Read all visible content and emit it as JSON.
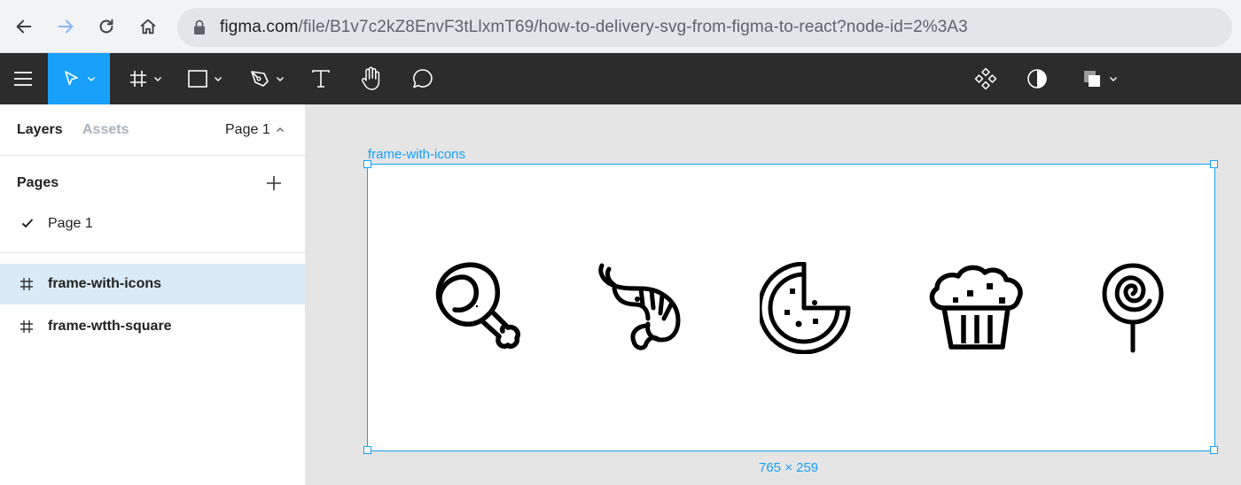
{
  "browser": {
    "url_host": "figma.com",
    "url_path": "/file/B1v7c2kZ8EnvF3tLlxmT69/how-to-delivery-svg-from-figma-to-react?node-id=2%3A3",
    "icons": [
      "back-arrow-icon",
      "forward-arrow-icon",
      "reload-icon",
      "home-icon",
      "lock-icon"
    ]
  },
  "toolbar": {
    "tools": [
      "menu-icon",
      "move-icon",
      "frame-icon",
      "rectangle-icon",
      "pen-icon",
      "text-icon",
      "hand-icon",
      "comment-icon"
    ],
    "active_tool": "move-icon",
    "right_tools": [
      "components-icon",
      "mask-icon",
      "boolean-icon"
    ],
    "accent": "#18a0fb",
    "background": "#2c2c2c"
  },
  "left_panel": {
    "tabs": {
      "layers": "Layers",
      "assets": "Assets"
    },
    "current_page": "Page 1",
    "pages_title": "Pages",
    "pages": [
      {
        "label": "Page 1",
        "checked": true
      }
    ],
    "layers": [
      {
        "label": "frame-with-icons",
        "selected": true
      },
      {
        "label": "frame-wtth-square",
        "selected": false
      }
    ],
    "selected_color": "#daebf7"
  },
  "canvas": {
    "frame_name": "frame-with-icons",
    "frame_size": "765 × 259",
    "icons": [
      "ham-leg-icon",
      "shrimp-icon",
      "pizza-icon",
      "cupcake-icon",
      "lollipop-icon"
    ],
    "background": "#e5e5e5",
    "selection_color": "#18a0fb"
  }
}
